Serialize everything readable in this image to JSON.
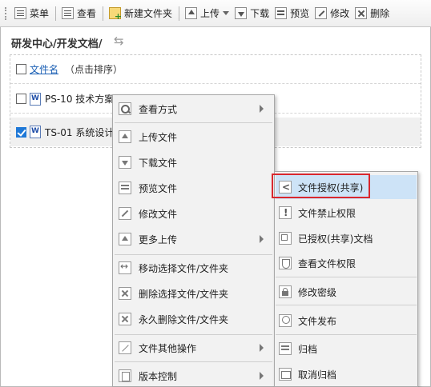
{
  "toolbar": {
    "menu": "菜单",
    "view": "查看",
    "new_folder": "新建文件夹",
    "upload": "上传",
    "download": "下载",
    "preview": "预览",
    "modify": "修改",
    "delete": "删除"
  },
  "path": "研发中心/开发文档/",
  "list": {
    "header_link": "文件名",
    "header_hint": "（点击排序）",
    "rows": [
      {
        "name": "PS-10 技术方案",
        "checked": false
      },
      {
        "name": "TS-01 系统设计",
        "checked": true
      }
    ]
  },
  "context_menu": {
    "items": [
      {
        "label": "查看方式",
        "icon": "search-icon",
        "submenu": true
      },
      {
        "label": "上传文件",
        "icon": "upload-icon"
      },
      {
        "label": "下载文件",
        "icon": "download-icon"
      },
      {
        "label": "预览文件",
        "icon": "preview-icon"
      },
      {
        "label": "修改文件",
        "icon": "edit-icon"
      },
      {
        "label": "更多上传",
        "icon": "upload-more-icon",
        "submenu": true
      },
      {
        "label": "移动选择文件/文件夹",
        "icon": "move-icon"
      },
      {
        "label": "删除选择文件/文件夹",
        "icon": "delete-icon"
      },
      {
        "label": "永久删除文件/文件夹",
        "icon": "permanent-delete-icon"
      },
      {
        "label": "文件其他操作",
        "icon": "other-ops-icon",
        "submenu": true
      },
      {
        "label": "版本控制",
        "icon": "version-icon",
        "submenu": true
      }
    ]
  },
  "submenu": {
    "items": [
      {
        "label": "文件授权(共享)",
        "icon": "share-icon",
        "highlighted": true
      },
      {
        "label": "文件禁止权限",
        "icon": "ban-icon"
      },
      {
        "label": "已授权(共享)文档",
        "icon": "shared-docs-icon"
      },
      {
        "label": "查看文件权限",
        "icon": "shield-icon"
      },
      {
        "label": "修改密级",
        "icon": "lock-icon"
      },
      {
        "label": "文件发布",
        "icon": "bulb-icon"
      },
      {
        "label": "归档",
        "icon": "archive-icon"
      },
      {
        "label": "取消归档",
        "icon": "unarchive-icon"
      }
    ]
  },
  "colors": {
    "highlight_fill": "#cde3f7",
    "highlight_border": "#d9272e",
    "link": "#1a5fb4",
    "checkbox_on": "#1e78d7"
  }
}
